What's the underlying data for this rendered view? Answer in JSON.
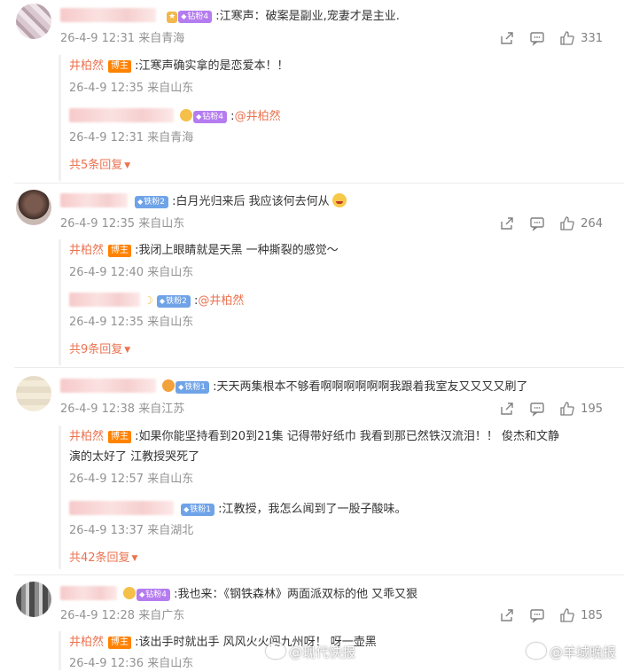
{
  "threads": [
    {
      "badge": "钻粉4",
      "badge_type": "diamond",
      "text": ":江寒声：破案是副业,宠妻才是主业.",
      "meta": "26-4-9 12:31 来自青海",
      "likes": "331",
      "replies": [
        {
          "host": true,
          "name": "井柏然",
          "tag": "博主",
          "text": ":江寒声确实拿的是恋爱本！！",
          "meta": "26-4-9 12:35 来自山东"
        },
        {
          "host": false,
          "badge": "钻粉4",
          "badge_type": "diamond",
          "text": ":",
          "mention": "@井柏然",
          "meta": "26-4-9 12:31 来自青海"
        }
      ],
      "more": "共5条回复"
    },
    {
      "badge": "铁粉2",
      "badge_type": "iron",
      "text": ":白月光归来后 我应该何去何从",
      "meta": "26-4-9 12:35 来自山东",
      "likes": "264",
      "replies": [
        {
          "host": true,
          "name": "井柏然",
          "tag": "博主",
          "text": ":我闭上眼睛就是天黑 一种撕裂的感觉～",
          "meta": "26-4-9 12:40 来自山东"
        },
        {
          "host": false,
          "badge": "铁粉2",
          "badge_type": "iron",
          "text": ":",
          "mention": "@井柏然",
          "meta": "26-4-9 12:35 来自山东"
        }
      ],
      "more": "共9条回复"
    },
    {
      "badge": "铁粉1",
      "badge_type": "iron",
      "text": ":天天两集根本不够看啊啊啊啊啊啊我跟着我室友又又又又刷了",
      "meta": "26-4-9 12:38 来自江苏",
      "likes": "195",
      "replies": [
        {
          "host": true,
          "name": "井柏然",
          "tag": "博主",
          "text": ":如果你能坚持看到20到21集 记得带好纸巾 我看到那已然铁汉流泪！！ 俊杰和文静",
          "text2": "演的太好了 江教授哭死了",
          "meta": "26-4-9 12:57 来自山东"
        },
        {
          "host": false,
          "badge": "铁粉1",
          "badge_type": "iron",
          "text": ":江教授，我怎么闻到了一股子酸味。",
          "meta": "26-4-9 13:37 来自湖北"
        }
      ],
      "more": "共42条回复"
    },
    {
      "badge": "钻粉4",
      "badge_type": "diamond",
      "text": ":我也来：《钢铁森林》两面派双标的他  又乖又狠",
      "meta": "26-4-9 12:28 来自广东",
      "likes": "185",
      "replies": [
        {
          "host": true,
          "name": "井柏然",
          "tag": "博主",
          "text": ":该出手时就出手 风风火火闯九州呀！ 呀一壶黑",
          "meta": "26-4-9 12:36 来自山东"
        }
      ]
    }
  ],
  "watermarks": {
    "left": "@现代快报",
    "right": "@羊城晚报"
  },
  "icons": {
    "share": "share-icon",
    "comment": "comment-icon",
    "like": "thumbs-up-icon"
  },
  "colors": {
    "host_name": "#eb7350",
    "host_tag": "#ff8200",
    "meta": "#939393",
    "diamond_badge": "#b57cf0",
    "iron_badge": "#6fa3e8"
  }
}
